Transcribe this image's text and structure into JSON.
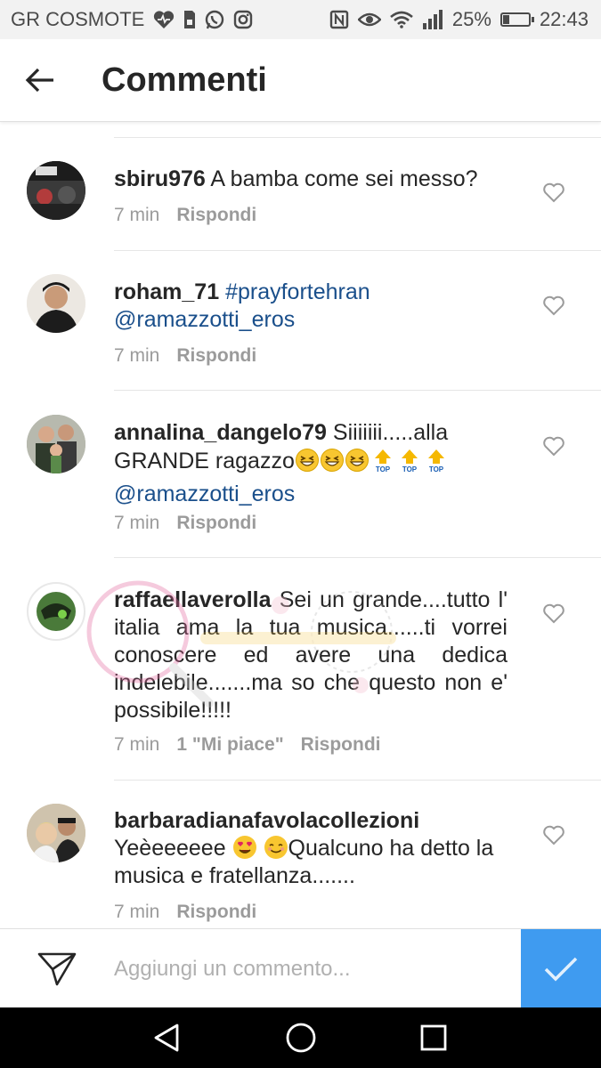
{
  "status_bar": {
    "carrier": "GR COSMOTE",
    "battery_percent": "25%",
    "battery_level": 0.25,
    "time": "22:43",
    "icons": [
      "heart-pulse-icon",
      "sim-icon",
      "whatsapp-icon",
      "instagram-icon",
      "nfc-icon",
      "eye-icon",
      "wifi-icon",
      "signal-icon",
      "battery-icon"
    ]
  },
  "header": {
    "title": "Commenti",
    "back_icon": "arrow-left-icon"
  },
  "comments": [
    {
      "username": "sbiru976",
      "text": "A bamba come sei messo?",
      "time": "7 min",
      "reply_label": "Rispondi"
    },
    {
      "username": "roham_71",
      "hashtag": "#prayforteh​ran",
      "mention": "@ramazzotti_eros",
      "time": "7 min",
      "reply_label": "Rispondi"
    },
    {
      "username": "annalina_dangelo79",
      "text_1": "Siiiiiii.....alla",
      "text_2": "GRANDE ragazzo",
      "emojis": [
        "grinning-squinting-face-emoji",
        "grinning-squinting-face-emoji",
        "grinning-squinting-face-emoji",
        "top-arrow-emoji",
        "top-arrow-emoji",
        "top-arrow-emoji"
      ],
      "top_label": "TOP",
      "mention": "@ramazzotti_eros",
      "time": "7 min",
      "reply_label": "Rispondi"
    },
    {
      "username": "raffaellaverolla",
      "text": "Sei un grande....tutto l' italia ama la tua musica......ti vorrei conoscere ed avere una dedica indelebile.......ma so che questo non e' possibile!!!!!",
      "time": "7 min",
      "likes": "1 \"Mi piace\"",
      "reply_label": "Rispondi"
    },
    {
      "username": "barbaradianafavolacollezioni",
      "text_1": "Yeèeeeeee",
      "text_2": "Qualcuno ha detto la musica e  fratellanza.......",
      "emojis": [
        "heart-eyes-emoji",
        "smiling-face-emoji"
      ],
      "time": "7 min",
      "reply_label": "Rispondi"
    }
  ],
  "input": {
    "placeholder": "Aggiungi un commento...",
    "direct_icon": "paper-plane-icon",
    "post_icon": "checkmark-icon"
  },
  "nav": {
    "icons": [
      "back-triangle-icon",
      "home-circle-icon",
      "recents-square-icon"
    ]
  },
  "colors": {
    "link": "#1a4f8b",
    "post_button": "#3f9bf0",
    "meta": "#9b9b9b"
  }
}
